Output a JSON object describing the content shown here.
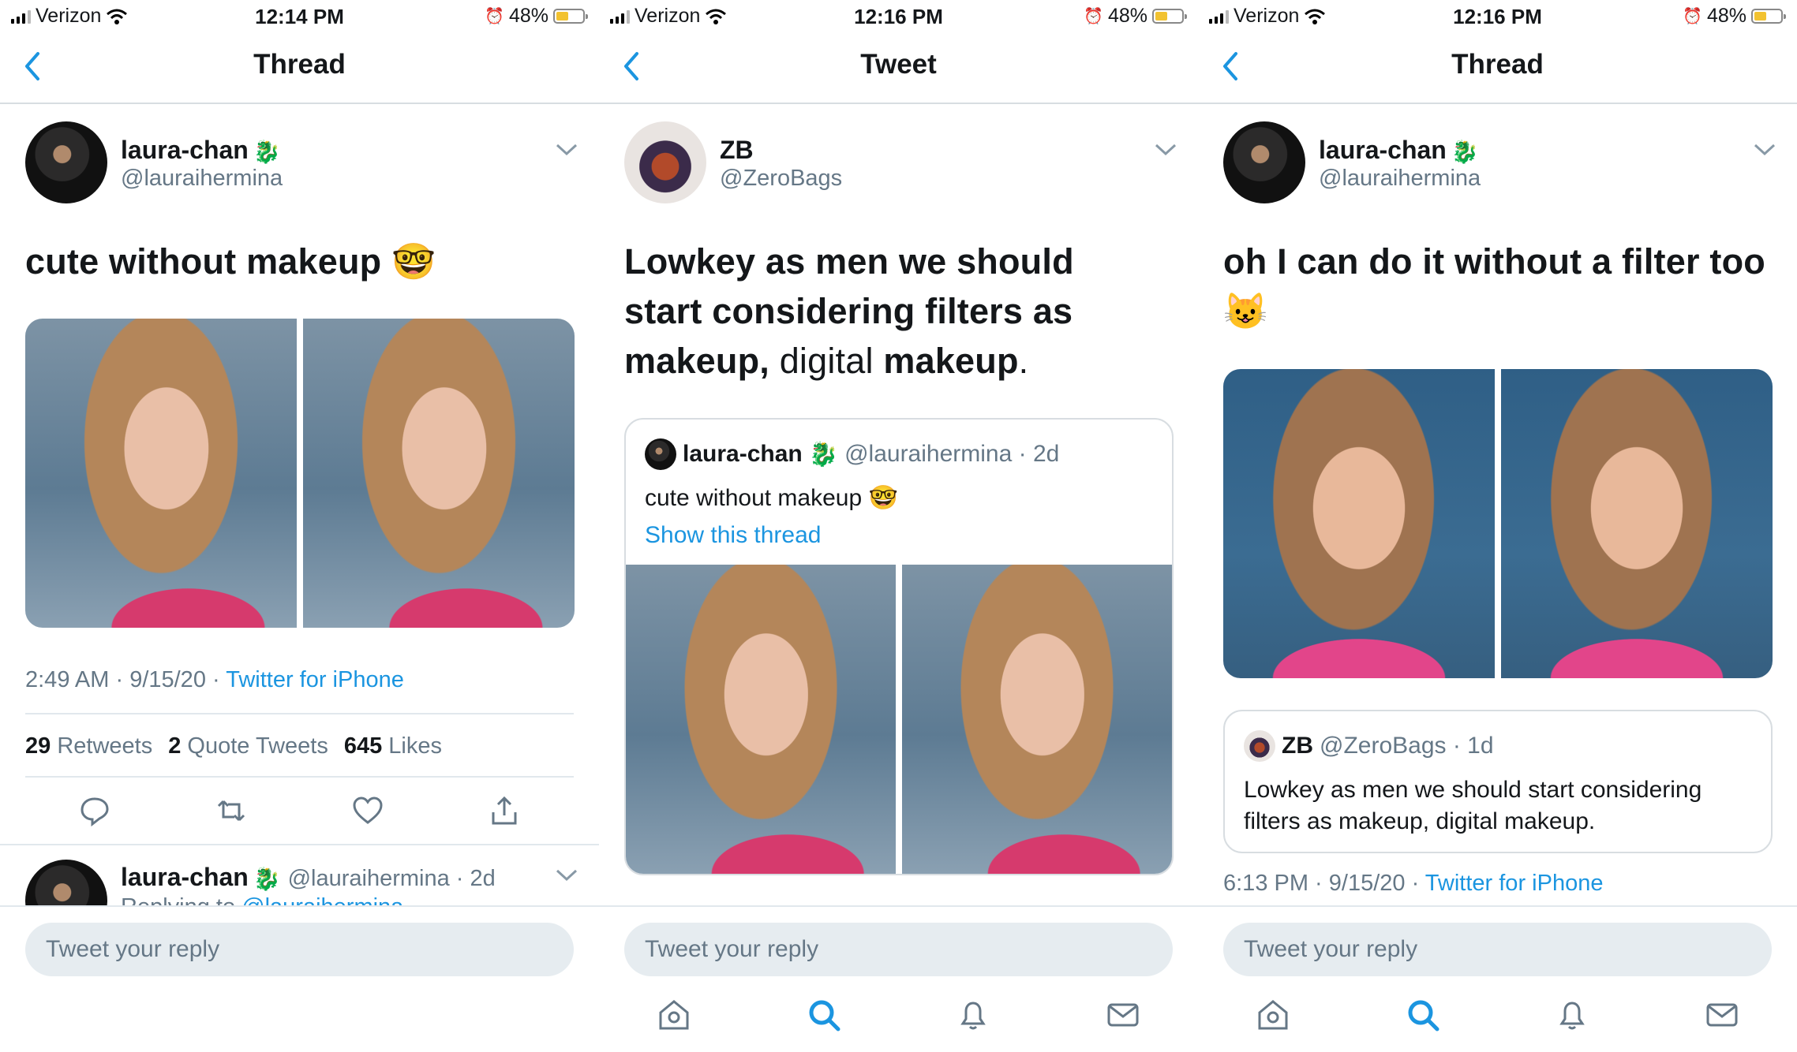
{
  "status_bars": [
    {
      "carrier": "Verizon",
      "time": "12:14 PM",
      "battery": "48%",
      "battery_level": 0.48
    },
    {
      "carrier": "Verizon",
      "time": "12:16 PM",
      "battery": "48%",
      "battery_level": 0.48
    },
    {
      "carrier": "Verizon",
      "time": "12:16 PM",
      "battery": "48%",
      "battery_level": 0.48
    }
  ],
  "panel1": {
    "nav_title": "Thread",
    "author": {
      "name": "laura-chan",
      "badge": "🐉",
      "handle": "@lauraihermina"
    },
    "text": "cute without makeup 🤓",
    "meta": {
      "time": "2:49 AM",
      "date": "9/15/20",
      "source": "Twitter for iPhone"
    },
    "stats": {
      "retweets": "29",
      "retweets_label": "Retweets",
      "quotes": "2",
      "quotes_label": "Quote Tweets",
      "likes": "645",
      "likes_label": "Likes"
    },
    "actions": [
      "reply-icon",
      "retweet-icon",
      "like-icon",
      "share-icon"
    ],
    "reply": {
      "name": "laura-chan",
      "badge": "🐉",
      "handle": "@lauraihermina · 2d",
      "replying_prefix": "Replying to ",
      "replying_handle": "@lauraihermina"
    }
  },
  "panel2": {
    "nav_title": "Tweet",
    "author": {
      "name": "ZB",
      "handle": "@ZeroBags"
    },
    "text_bold1": "Lowkey as men we should start considering filters as makeup,",
    "text_light": "digital ",
    "text_bold2": "makeup",
    "text_end": ".",
    "quote": {
      "name": "laura-chan",
      "badge": "🐉",
      "handle": "@lauraihermina · 2d",
      "text": "cute without makeup 🤓",
      "link": "Show this thread"
    }
  },
  "panel3": {
    "nav_title": "Thread",
    "author": {
      "name": "laura-chan",
      "badge": "🐉",
      "handle": "@lauraihermina"
    },
    "text": "oh I can do it without a filter too 😺",
    "quote": {
      "name": "ZB",
      "handle": "@ZeroBags · 1d",
      "text": "Lowkey as men we should start considering filters as makeup, digital makeup."
    },
    "meta": {
      "time": "6:13 PM",
      "date": "9/15/20",
      "source": "Twitter for iPhone"
    }
  },
  "reply_placeholder": "Tweet your reply",
  "tabbar": [
    "home-icon",
    "search-icon",
    "notifications-icon",
    "messages-icon"
  ],
  "colors": {
    "accent": "#1b95e0",
    "secondary_text": "#657786",
    "battery": "#f2c230"
  }
}
